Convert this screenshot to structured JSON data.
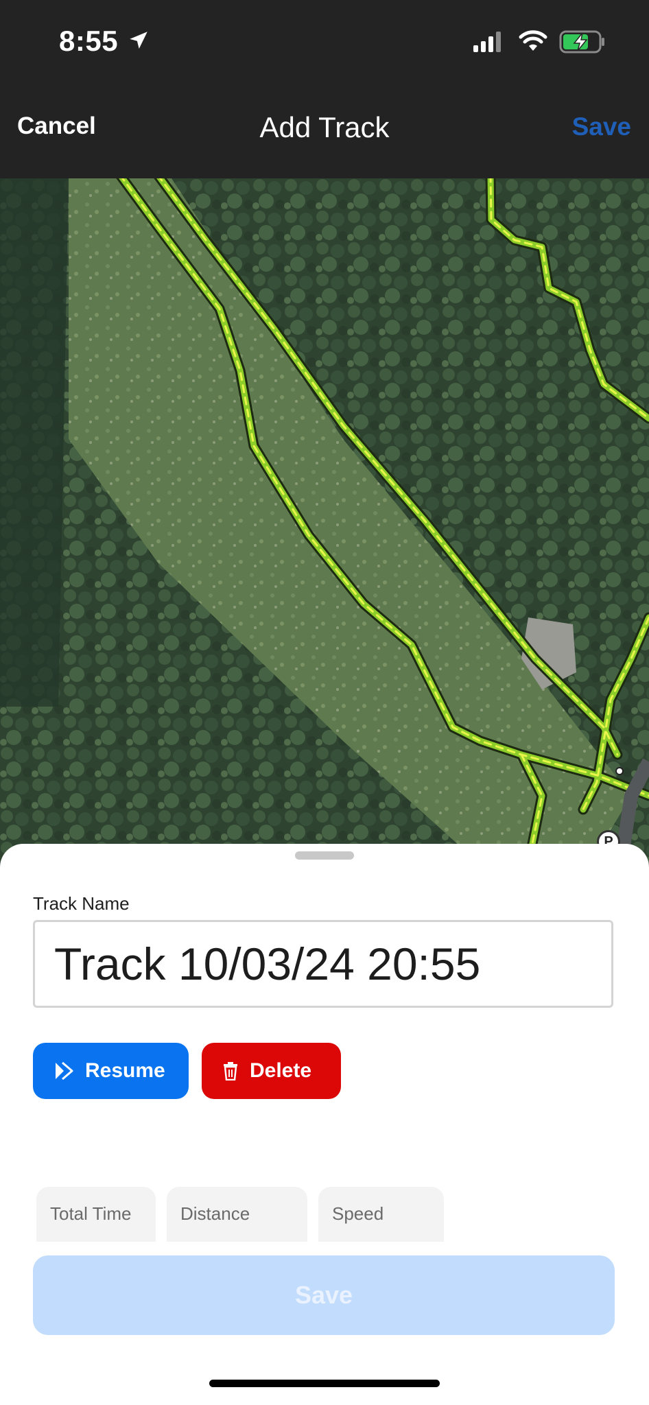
{
  "status_bar": {
    "time": "8:55",
    "icons": [
      "location-arrow-icon",
      "cellular-signal-icon",
      "wifi-icon",
      "battery-charging-icon"
    ]
  },
  "nav": {
    "cancel_label": "Cancel",
    "title": "Add Track",
    "save_label": "Save"
  },
  "map": {
    "type": "satellite",
    "trail_color": "#b8e63a",
    "marker_label": "P"
  },
  "sheet": {
    "track_name_label": "Track Name",
    "track_name_value": "Track 10/03/24 20:55",
    "resume_label": "Resume",
    "delete_label": "Delete",
    "stats": {
      "total_time_label": "Total Time",
      "distance_label": "Distance",
      "speed_label": "Speed"
    },
    "save_label": "Save"
  },
  "colors": {
    "accent_blue": "#0a74f0",
    "delete_red": "#dc0808",
    "disabled_blue": "#c1dcfc",
    "nav_background": "#232323"
  }
}
